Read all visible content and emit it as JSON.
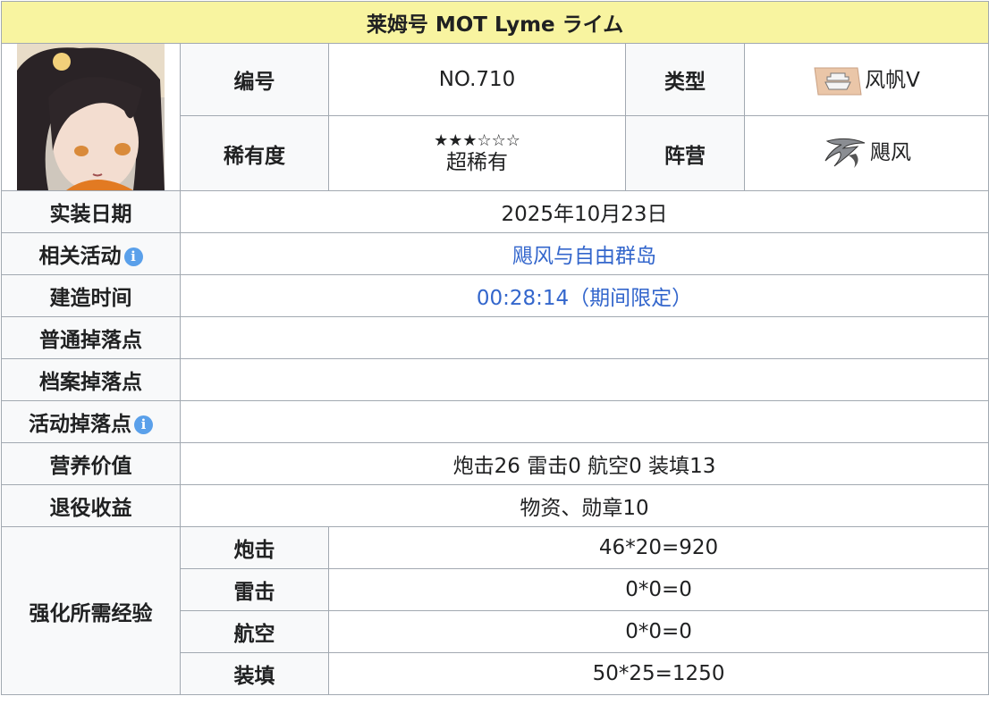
{
  "title": "莱姆号 MOT Lyme ライム",
  "labels": {
    "number": "编号",
    "type": "类型",
    "rarity": "稀有度",
    "faction": "阵营",
    "release_date": "实装日期",
    "related_event": "相关活动",
    "build_time": "建造时间",
    "normal_drop": "普通掉落点",
    "archive_drop": "档案掉落点",
    "event_drop": "活动掉落点",
    "nutrition": "营养价值",
    "retire": "退役收益",
    "enhance_exp": "强化所需经验"
  },
  "values": {
    "number": "NO.710",
    "type": "风帆V",
    "rarity_stars": "★★★☆☆☆",
    "rarity_name": "超稀有",
    "faction": "飓风",
    "release_date": "2025年10月23日",
    "related_event": "飓风与自由群岛",
    "build_time": "00:28:14（期间限定）",
    "normal_drop": "",
    "archive_drop": "",
    "event_drop": "",
    "nutrition": "炮击26 雷击0 航空0 装填13",
    "retire": "物资、勋章10"
  },
  "enhance": [
    {
      "label": "炮击",
      "value": "46*20=920"
    },
    {
      "label": "雷击",
      "value": "0*0=0"
    },
    {
      "label": "航空",
      "value": "0*0=0"
    },
    {
      "label": "装填",
      "value": "50*25=1250"
    }
  ],
  "colors": {
    "title_bg": "#f8f4a0",
    "link": "#3366cc",
    "info_icon": "#5aa0ea",
    "border": "#a2a9b1"
  },
  "icons": {
    "info": "i"
  }
}
